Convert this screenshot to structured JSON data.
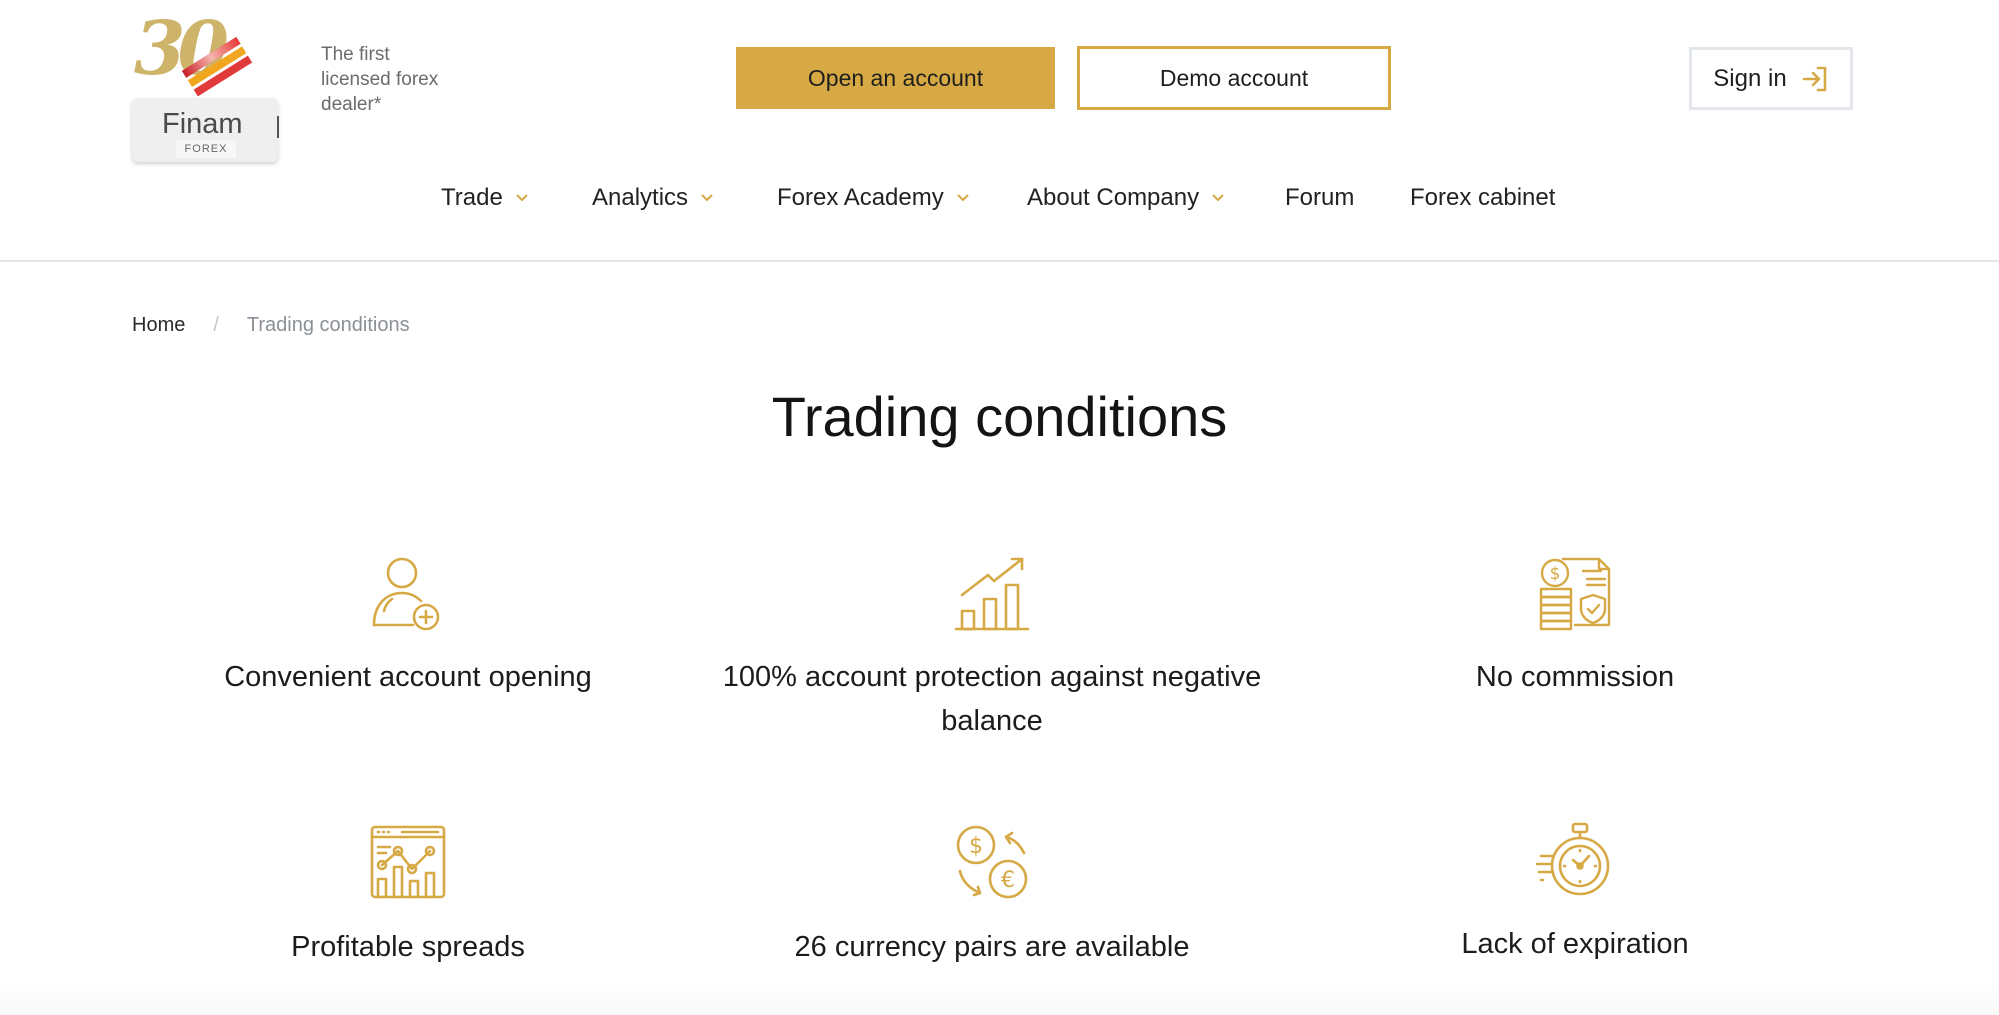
{
  "brand": {
    "logo_number": "30",
    "logo_name": "Finam",
    "logo_sub": "FOREX",
    "tagline": "The first licensed forex dealer*",
    "accent_color": "#d6a945"
  },
  "header": {
    "open_account_label": "Open an account",
    "demo_account_label": "Demo account",
    "sign_in_label": "Sign in"
  },
  "nav": {
    "items": [
      {
        "label": "Trade",
        "has_dropdown": true
      },
      {
        "label": "Analytics",
        "has_dropdown": true
      },
      {
        "label": "Forex Academy",
        "has_dropdown": true
      },
      {
        "label": "About Company",
        "has_dropdown": true
      },
      {
        "label": "Forum",
        "has_dropdown": false
      },
      {
        "label": "Forex cabinet",
        "has_dropdown": false
      }
    ]
  },
  "breadcrumb": {
    "home": "Home",
    "separator": "/",
    "current": "Trading conditions"
  },
  "page": {
    "title": "Trading conditions"
  },
  "features": [
    {
      "icon": "user-plus-icon",
      "label": "Convenient account opening"
    },
    {
      "icon": "growth-chart-icon",
      "label": "100% account protection against negative balance"
    },
    {
      "icon": "coins-document-shield-icon",
      "label": "No commission"
    },
    {
      "icon": "analytics-window-icon",
      "label": "Profitable spreads"
    },
    {
      "icon": "currency-exchange-icon",
      "label": "26 currency pairs are available"
    },
    {
      "icon": "stopwatch-icon",
      "label": "Lack of expiration"
    }
  ]
}
